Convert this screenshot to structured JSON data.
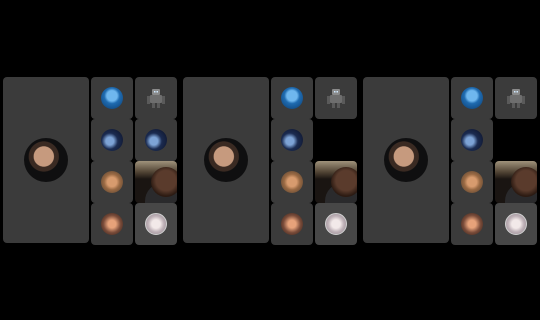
{
  "panels": [
    {
      "name": "panel-1",
      "speaker_avatar": "man-avatar",
      "tiles": [
        {
          "slot": "r0c0",
          "kind": "avatar",
          "avatar": "blue-abstract-avatar"
        },
        {
          "slot": "r0c1",
          "kind": "avatar",
          "avatar": "robot-avatar"
        },
        {
          "slot": "r1c0",
          "kind": "avatar",
          "avatar": "dark-artwork-avatar"
        },
        {
          "slot": "r1c1",
          "kind": "avatar",
          "avatar": "blue-figure-avatar"
        },
        {
          "slot": "r2c0",
          "kind": "avatar",
          "avatar": "blonde-avatar"
        },
        {
          "slot": "r2c1",
          "kind": "video",
          "avatar": "camera-feed"
        },
        {
          "slot": "r3c0",
          "kind": "avatar",
          "avatar": "cat-avatar"
        },
        {
          "slot": "r3c1",
          "kind": "avatar-active",
          "avatar": "white-hair-avatar"
        }
      ]
    },
    {
      "name": "panel-2",
      "speaker_avatar": "man-avatar",
      "tiles": [
        {
          "slot": "r0c0",
          "kind": "avatar",
          "avatar": "blue-abstract-avatar"
        },
        {
          "slot": "r0c1",
          "kind": "avatar",
          "avatar": "robot-avatar"
        },
        {
          "slot": "r1c0",
          "kind": "avatar",
          "avatar": "dark-artwork-avatar"
        },
        {
          "slot": "r2c0",
          "kind": "avatar",
          "avatar": "blonde-avatar"
        },
        {
          "slot": "r2c1",
          "kind": "video",
          "avatar": "camera-feed"
        },
        {
          "slot": "r3c0",
          "kind": "avatar",
          "avatar": "cat-avatar"
        },
        {
          "slot": "r3c1",
          "kind": "avatar-active",
          "avatar": "white-hair-avatar"
        }
      ]
    },
    {
      "name": "panel-3",
      "speaker_avatar": "man-avatar",
      "tiles": [
        {
          "slot": "r0c0",
          "kind": "avatar",
          "avatar": "blue-abstract-avatar"
        },
        {
          "slot": "r0c1",
          "kind": "avatar",
          "avatar": "robot-avatar"
        },
        {
          "slot": "r1c0",
          "kind": "avatar",
          "avatar": "dark-artwork-avatar"
        },
        {
          "slot": "r2c0",
          "kind": "avatar",
          "avatar": "blonde-avatar"
        },
        {
          "slot": "r2c1",
          "kind": "video",
          "avatar": "camera-feed"
        },
        {
          "slot": "r3c0",
          "kind": "avatar",
          "avatar": "cat-avatar"
        },
        {
          "slot": "r3c1",
          "kind": "avatar-active",
          "avatar": "white-hair-avatar"
        }
      ]
    }
  ],
  "colors": {
    "background": "#000000",
    "tile": "#3b3b3b",
    "tile_active": "#474747"
  }
}
